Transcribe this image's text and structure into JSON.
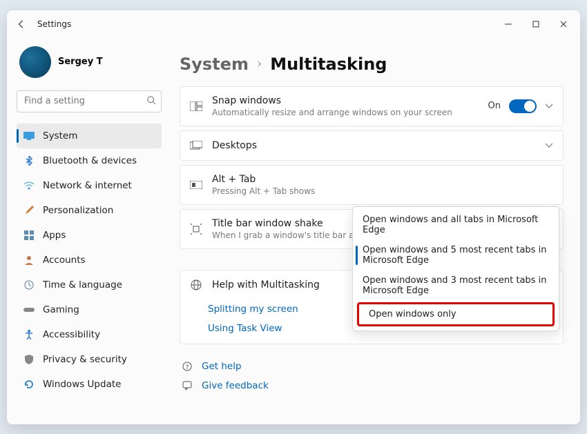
{
  "window": {
    "title": "Settings"
  },
  "profile": {
    "name": "Sergey T"
  },
  "search": {
    "placeholder": "Find a setting"
  },
  "nav": {
    "system": "System",
    "bluetooth": "Bluetooth & devices",
    "network": "Network & internet",
    "personalization": "Personalization",
    "apps": "Apps",
    "accounts": "Accounts",
    "time": "Time & language",
    "gaming": "Gaming",
    "accessibility": "Accessibility",
    "privacy": "Privacy & security",
    "update": "Windows Update"
  },
  "breadcrumb": {
    "parent": "System",
    "page": "Multitasking"
  },
  "snap": {
    "title": "Snap windows",
    "subtitle": "Automatically resize and arrange windows on your screen",
    "state": "On"
  },
  "desktops": {
    "title": "Desktops"
  },
  "alttab": {
    "title": "Alt + Tab",
    "subtitle": "Pressing Alt + Tab shows",
    "options": {
      "o1": "Open windows and all tabs in Microsoft Edge",
      "o2": "Open windows and 5 most recent tabs in Microsoft Edge",
      "o3": "Open windows and 3 most recent tabs in Microsoft Edge",
      "o4": "Open windows only"
    }
  },
  "shake": {
    "title": "Title bar window shake",
    "subtitle": "When I grab a window's title bar and shake it, min"
  },
  "help": {
    "title": "Help with Multitasking",
    "link1": "Splitting my screen",
    "link2": "Using Task View"
  },
  "footer": {
    "gethelp": "Get help",
    "feedback": "Give feedback"
  }
}
